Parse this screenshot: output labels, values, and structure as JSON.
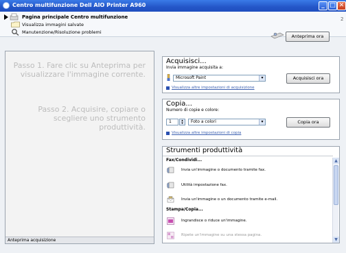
{
  "window": {
    "title": "Centro multifunzione Dell AIO Printer A960",
    "minimize": "_",
    "maximize": "□",
    "close": "✕"
  },
  "nav": {
    "items": [
      {
        "label": "Pagina principale Centro multifunzione"
      },
      {
        "label": "Visualizza immagini salvate"
      },
      {
        "label": "Manutenzione/Risoluzione problemi"
      }
    ],
    "page_corner": "2"
  },
  "preview_button": {
    "label": "Anteprima ora"
  },
  "preview_panel": {
    "step1": "Passo 1. Fare clic su Anteprima per visualizzare l'immagine corrente.",
    "step2": "Passo 2. Acquisire, copiare o scegliere uno strumento produttività.",
    "status": "Anteprima acquisizione"
  },
  "acquire": {
    "title": "Acquisisci...",
    "subtitle": "Invia immagine acquisita a:",
    "destination": "Microsoft Paint",
    "button": "Acquisisci ora",
    "link": "Visualizza altre impostazioni di acquisizione"
  },
  "copy": {
    "title": "Copia...",
    "subtitle": "Numero di copie e colore:",
    "copies": "1",
    "color": "Foto a colori",
    "button": "Copia ora",
    "link": "Visualizza altre impostazioni di copia"
  },
  "tools": {
    "title": "Strumenti produttività",
    "section1": "Fax/Condividi...",
    "fax1": "Invia un'immagine o documento tramite fax.",
    "fax2": "Utilità impostazione fax.",
    "email": "Invia un'immagine o un documento tramite e-mail.",
    "section2": "Stampa/Copia...",
    "resize": "Ingrandisce o riduce un'immagine.",
    "poster": "Ripete un'immagine su una stessa pagina."
  },
  "colors": {
    "titlebar": "#2456c8",
    "link": "#3a5fb0"
  }
}
